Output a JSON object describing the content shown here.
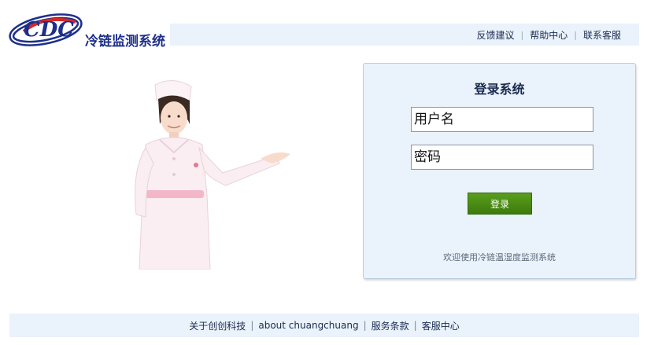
{
  "header": {
    "logo_text": "冷链监测系统",
    "logo_letters": "CDC",
    "nav": [
      "反馈建议",
      "帮助中心",
      "联系客服"
    ]
  },
  "login": {
    "title": "登录系统",
    "username_placeholder": "用户名",
    "password_placeholder": "密码",
    "submit_label": "登录",
    "welcome_text": "欢迎使用冷链温湿度监测系统"
  },
  "footer": {
    "links": [
      "关于创创科技",
      "about chuangchuang",
      "服务条款",
      "客服中心"
    ]
  },
  "colors": {
    "brand": "#1d2f8a",
    "accent_red": "#d62828",
    "panel_bg": "#eaf2fb",
    "button_green": "#4a8c15"
  }
}
